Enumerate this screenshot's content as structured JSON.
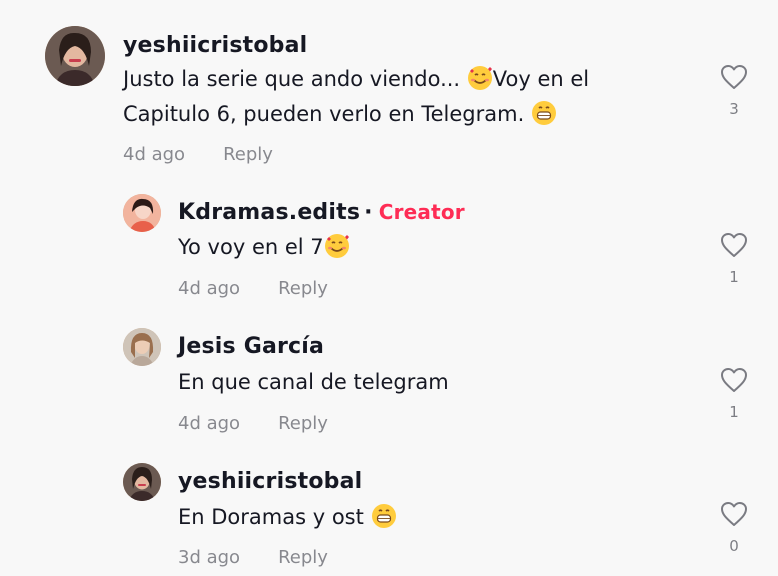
{
  "comments": [
    {
      "username": "yeshiicristobal",
      "text_line1_a": "Justo la serie que ando viendo... ",
      "text_line1_b": "Voy en el",
      "text_line2": "Capitulo 6, pueden verlo en Telegram. ",
      "time": "4d ago",
      "reply": "Reply",
      "likes": "3"
    },
    {
      "username": "Kdramas.edits",
      "separator": "·",
      "badge": "Creator",
      "text": "Yo voy en el 7",
      "time": "4d ago",
      "reply": "Reply",
      "likes": "1"
    },
    {
      "username": "Jesis García",
      "text": "En que canal de telegram",
      "time": "4d ago",
      "reply": "Reply",
      "likes": "1"
    },
    {
      "username": "yeshiicristobal",
      "text": "En Doramas y ost ",
      "time": "3d ago",
      "reply": "Reply",
      "likes": "0"
    }
  ],
  "icons": {
    "like": "heart-outline-icon",
    "emoji_love": "smiling-face-with-hearts-emoji",
    "emoji_grin": "grinning-face-emoji"
  },
  "colors": {
    "background": "#f8f8f8",
    "text": "#161823",
    "creator": "#fe2c55",
    "muted": "rgba(22,24,35,0.5)"
  }
}
